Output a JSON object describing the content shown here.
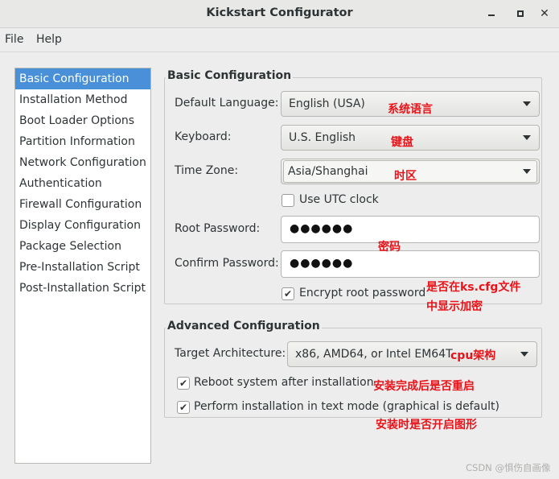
{
  "window": {
    "title": "Kickstart Configurator",
    "minimize_icon": "minimize-icon",
    "maximize_icon": "maximize-icon",
    "close_glyph": "✕"
  },
  "menu": {
    "file": "File",
    "help": "Help"
  },
  "sidebar": {
    "items": [
      {
        "label": "Basic Configuration",
        "selected": true
      },
      {
        "label": "Installation Method"
      },
      {
        "label": "Boot Loader Options"
      },
      {
        "label": "Partition Information"
      },
      {
        "label": "Network Configuration"
      },
      {
        "label": "Authentication"
      },
      {
        "label": "Firewall Configuration"
      },
      {
        "label": "Display Configuration"
      },
      {
        "label": "Package Selection"
      },
      {
        "label": "Pre-Installation Script"
      },
      {
        "label": "Post-Installation Script"
      }
    ]
  },
  "basic": {
    "title": "Basic Configuration",
    "language_label": "Default Language:",
    "language_value": "English (USA)",
    "keyboard_label": "Keyboard:",
    "keyboard_value": "U.S. English",
    "timezone_label": "Time Zone:",
    "timezone_value": "Asia/Shanghai",
    "utc_label": "Use UTC clock",
    "utc_checked": false,
    "root_password_label": "Root Password:",
    "root_password_mask": "●●●●●●",
    "confirm_password_label": "Confirm Password:",
    "confirm_password_mask": "●●●●●●",
    "encrypt_label": "Encrypt root password",
    "encrypt_checked": true
  },
  "advanced": {
    "title": "Advanced Configuration",
    "arch_label": "Target Architecture:",
    "arch_value": "x86, AMD64, or Intel EM64T",
    "reboot_label": "Reboot system after installation",
    "reboot_checked": true,
    "textmode_label": "Perform installation in text mode (graphical is default)",
    "textmode_checked": true
  },
  "check_glyph": "✔",
  "annotations": {
    "language": "系统语言",
    "keyboard": "键盘",
    "timezone": "时区",
    "password": "密码",
    "encrypt_line1": "是否在ks.cfg文件",
    "encrypt_line2": "中显示加密",
    "arch": "cpu架构",
    "reboot": "安装完成后是否重启",
    "textmode": "安装时是否开启图形",
    "color": "#e8141a"
  },
  "watermark": "CSDN @惧伤自画像"
}
